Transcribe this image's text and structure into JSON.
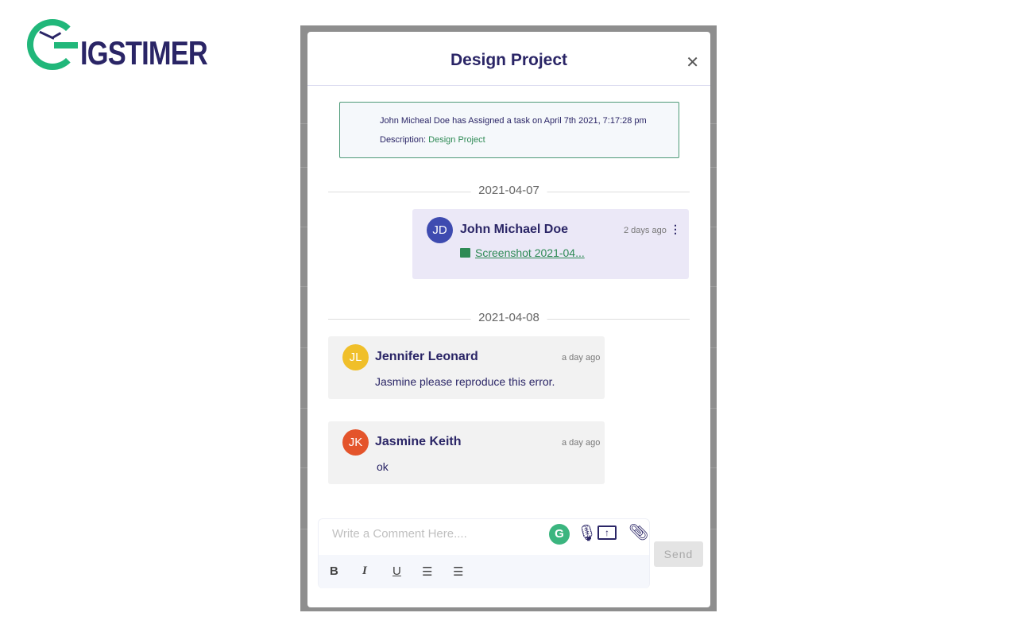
{
  "logo": {
    "text": "IGSTIMER",
    "brand_green": "#21b77a",
    "brand_navy": "#2a2566"
  },
  "modal": {
    "title": "Design Project",
    "close_icon": "close-icon",
    "notice": {
      "line1": "John Micheal Doe has Assigned a task on April 7th 2021, 7:17:28 pm",
      "desc_label": "Description: ",
      "desc_value": "Design Project"
    },
    "groups": [
      {
        "date": "2021-04-07"
      },
      {
        "date": "2021-04-08"
      }
    ],
    "messages": [
      {
        "initials": "JD",
        "name": "John Michael Doe",
        "time": "2 days ago",
        "attachment": "Screenshot 2021-04...",
        "avatar_color": "#3e4bb0"
      },
      {
        "initials": "JL",
        "name": "Jennifer Leonard",
        "time": "a day ago",
        "text": "Jasmine please reproduce this error.",
        "avatar_color": "#f0bf2a"
      },
      {
        "initials": "JK",
        "name": "Jasmine Keith",
        "time": "a day ago",
        "text": "ok",
        "avatar_color": "#e4542b"
      }
    ],
    "composer": {
      "placeholder": "Write a Comment Here....",
      "bold": "B",
      "italic": "I",
      "underline": "U",
      "send": "Send"
    }
  }
}
